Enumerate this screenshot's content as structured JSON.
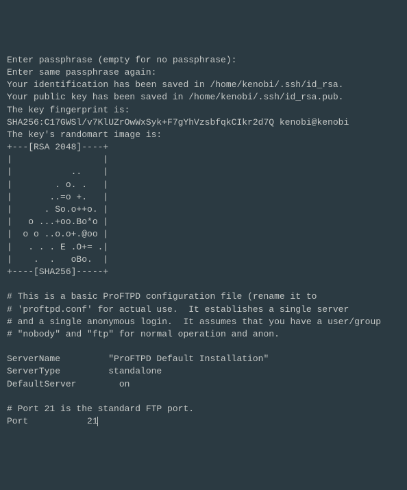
{
  "terminal": {
    "lines": [
      "Enter passphrase (empty for no passphrase):",
      "Enter same passphrase again:",
      "Your identification has been saved in /home/kenobi/.ssh/id_rsa.",
      "Your public key has been saved in /home/kenobi/.ssh/id_rsa.pub.",
      "The key fingerprint is:",
      "SHA256:C17GWSl/v7KlUZrOwWxSyk+F7gYhVzsbfqkCIkr2d7Q kenobi@kenobi",
      "The key's randomart image is:",
      "+---[RSA 2048]----+",
      "|                 |",
      "|           ..    |",
      "|        . o. .   |",
      "|       ..=o +.   |",
      "|      . So.o++o. |",
      "|   o ...+oo.Bo*o |",
      "|  o o ..o.o+.@oo |",
      "|   . . . E .O+= .|",
      "|    .  .   oBo.  |",
      "+----[SHA256]-----+",
      "",
      "# This is a basic ProFTPD configuration file (rename it to",
      "# 'proftpd.conf' for actual use.  It establishes a single server",
      "# and a single anonymous login.  It assumes that you have a user/group",
      "# \"nobody\" and \"ftp\" for normal operation and anon.",
      "",
      "ServerName         \"ProFTPD Default Installation\"",
      "ServerType         standalone",
      "DefaultServer        on",
      "",
      "# Port 21 is the standard FTP port.",
      "Port           21"
    ]
  }
}
